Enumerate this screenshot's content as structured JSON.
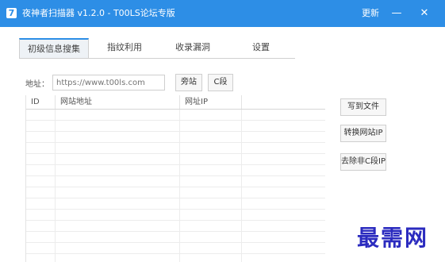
{
  "window": {
    "icon_glyph": "7",
    "title": "夜神者扫描器 v1.2.0 - T00LS论坛专版",
    "update_label": "更新",
    "minimize_glyph": "—",
    "close_glyph": "✕"
  },
  "tabs": [
    {
      "label": "初级信息搜集",
      "active": true
    },
    {
      "label": "指纹利用",
      "active": false
    },
    {
      "label": "收录漏洞",
      "active": false
    },
    {
      "label": "设置",
      "active": false
    }
  ],
  "address": {
    "label": "地址：",
    "placeholder": "https://www.t00ls.com",
    "value": ""
  },
  "buttons": {
    "side_site": "旁站",
    "c_segment": "C段",
    "write_file": "写到文件",
    "convert_ip": "转换网站IP",
    "remove_non_c": "去除非C段IP"
  },
  "table": {
    "columns": [
      "ID",
      "网站地址",
      "网址IP",
      ""
    ],
    "rows": []
  },
  "watermark": "最需网"
}
